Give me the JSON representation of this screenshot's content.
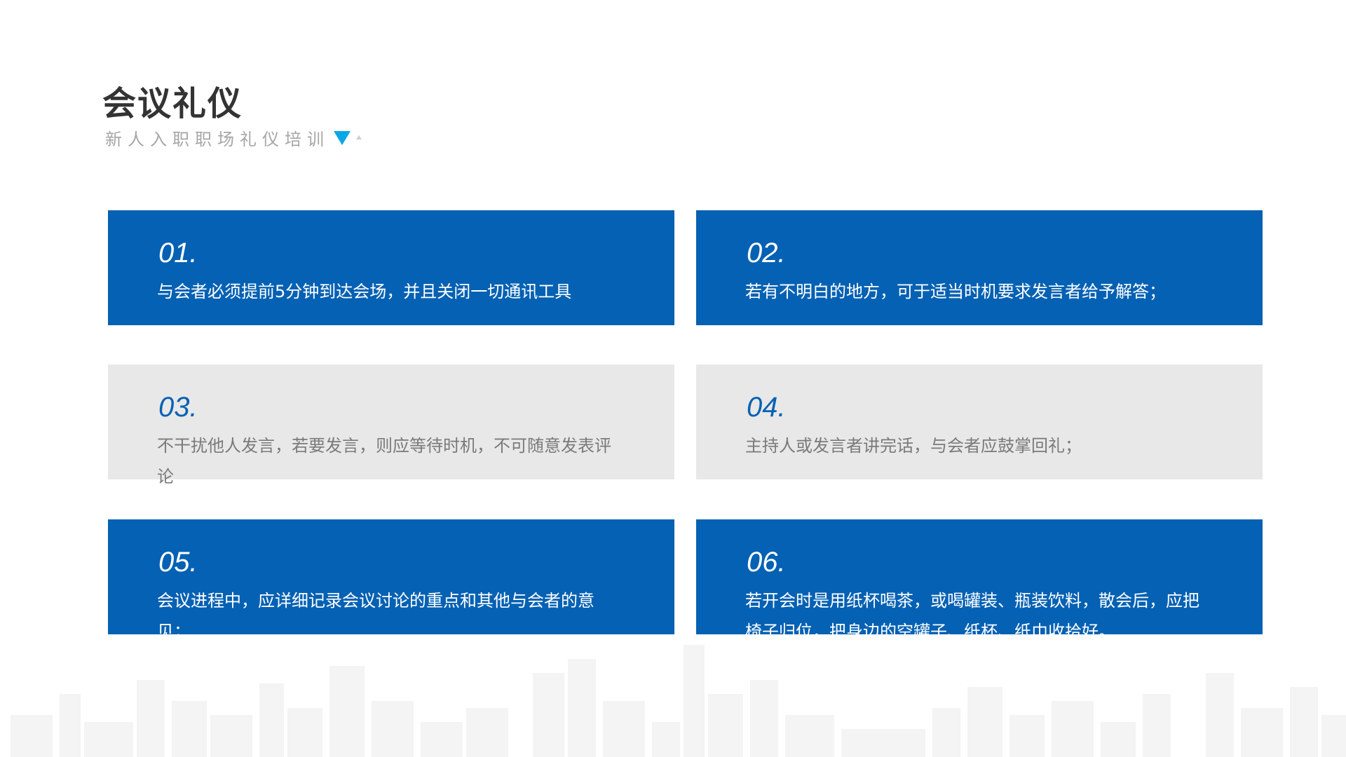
{
  "header": {
    "title": "会议礼仪",
    "subtitle": "新人入职职场礼仪培训"
  },
  "colors": {
    "primary_blue": "#0561b3",
    "light_gray": "#e8e8e8",
    "accent_cyan": "#0aa7e6"
  },
  "cards": [
    {
      "number": "01.",
      "text": "与会者必须提前5分钟到达会场，并且关闭一切通讯工具",
      "style": "blue"
    },
    {
      "number": "02.",
      "text": "若有不明白的地方，可于适当时机要求发言者给予解答；",
      "style": "blue"
    },
    {
      "number": "03.",
      "text": "不干扰他人发言，若要发言，则应等待时机，不可随意发表评论",
      "style": "gray"
    },
    {
      "number": "04.",
      "text": "主持人或发言者讲完话，与会者应鼓掌回礼；",
      "style": "gray"
    },
    {
      "number": "05.",
      "text": "会议进程中，应详细记录会议讨论的重点和其他与会者的意见；",
      "style": "blue"
    },
    {
      "number": "06.",
      "text": "若开会时是用纸杯喝茶，或喝罐装、瓶装饮料，散会后，应把椅子归位，把身边的空罐子、纸杯、纸巾收拾好。",
      "style": "blue"
    }
  ]
}
